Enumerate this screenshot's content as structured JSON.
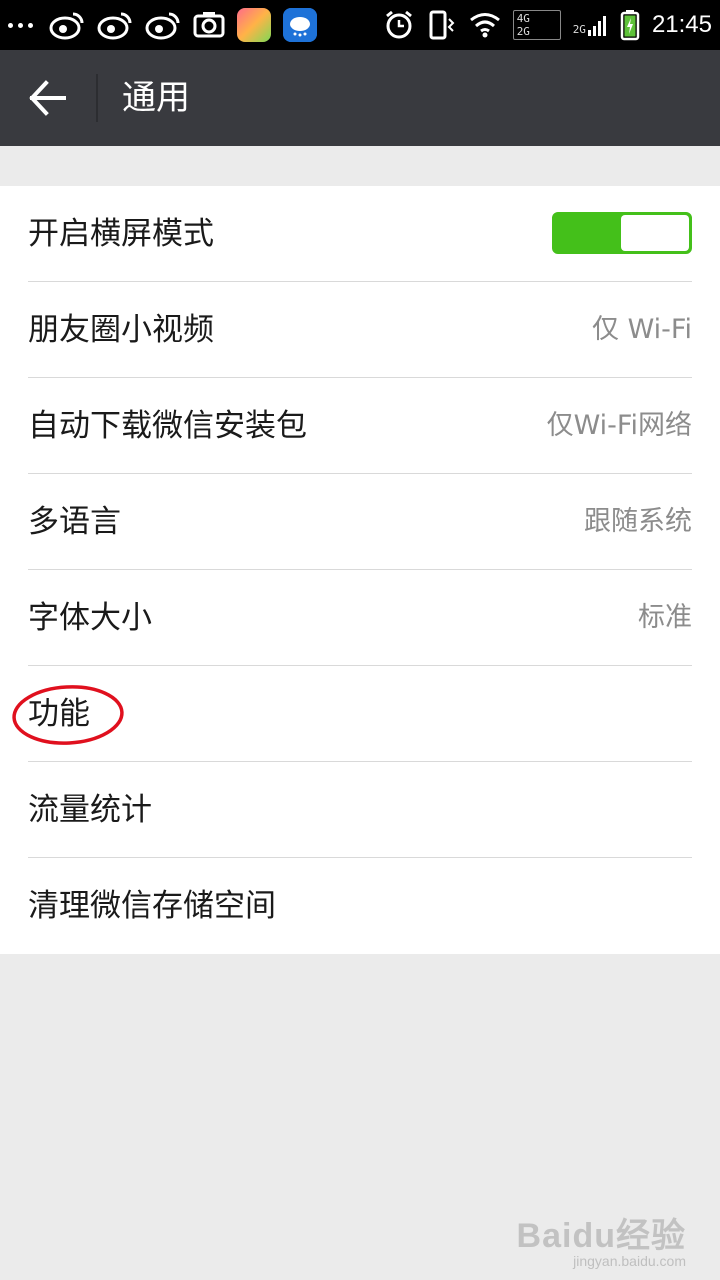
{
  "status_bar": {
    "time": "21:45",
    "net_top": "4G",
    "net_bottom": "2G",
    "net_secondary": "2G"
  },
  "header": {
    "title": "通用"
  },
  "settings": [
    {
      "label": "开启横屏模式",
      "toggle_on": true
    },
    {
      "label": "朋友圈小视频",
      "value": "仅 Wi-Fi"
    },
    {
      "label": "自动下载微信安装包",
      "value": "仅Wi-Fi网络"
    },
    {
      "label": "多语言",
      "value": "跟随系统"
    },
    {
      "label": "字体大小",
      "value": "标准"
    },
    {
      "label": "功能",
      "value": ""
    },
    {
      "label": "流量统计",
      "value": ""
    },
    {
      "label": "清理微信存储空间",
      "value": ""
    }
  ],
  "watermark": {
    "main": "Baidu经验",
    "sub": "jingyan.baidu.com"
  },
  "colors": {
    "toggle_on": "#44c01a",
    "titlebar": "#393a3f",
    "highlight_circle": "#e0101e"
  },
  "icons": [
    "weibo-icon",
    "camera-icon",
    "shirt-app-icon",
    "weather-app-icon",
    "alarm-icon",
    "vibrate-icon",
    "wifi-icon",
    "signal-icon",
    "battery-icon",
    "back-arrow-icon"
  ]
}
